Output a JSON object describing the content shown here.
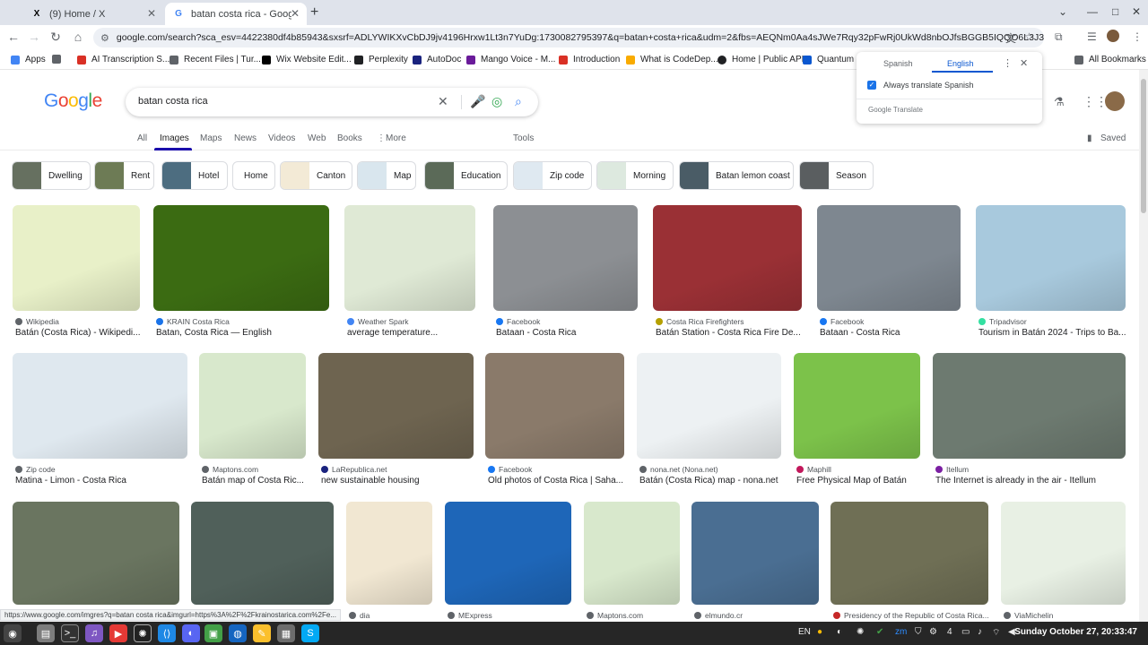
{
  "browser": {
    "tabs": [
      {
        "title": "(9) Home / X",
        "fav": "X"
      },
      {
        "title": "batan costa rica - Google Search",
        "fav": "G"
      }
    ],
    "url": "google.com/search?sca_esv=4422380df4b85943&sxsrf=ADLYWIKXvCbDJ9jv4196Hrxw1Lt3n7YuDg:1730082795397&q=batan+costa+rica&udm=2&fbs=AEQNm0Aa4sJWe7Rqy32pFwRj0UkWd8nbOJfsBGGB5IQQO6L3J3ppPdoHI1O-X...",
    "bookmarks": [
      {
        "label": "Apps",
        "color": "#4285f4"
      },
      {
        "label": "",
        "color": "#5f6368"
      },
      {
        "label": "AI Transcription S...",
        "color": "#d93025"
      },
      {
        "label": "Recent Files | Tur...",
        "color": "#5f6368"
      },
      {
        "label": "Wix Website Edit...",
        "color": "#000000"
      },
      {
        "label": "Perplexity",
        "color": "#202124"
      },
      {
        "label": "AutoDoc",
        "color": "#1a237e"
      },
      {
        "label": "Mango Voice - M...",
        "color": "#6a1b9a"
      },
      {
        "label": "Introduction",
        "color": "#d93025"
      },
      {
        "label": "What is CodeDep...",
        "color": "#f9ab00"
      },
      {
        "label": "Home | Public API",
        "color": "#202124"
      },
      {
        "label": "Quantum",
        "color": "#0b57d0"
      },
      {
        "label": "All Bookmarks",
        "color": "#5f6368"
      }
    ]
  },
  "translate": {
    "from": "Spanish",
    "to": "English",
    "checkbox": "Always translate Spanish",
    "footer": "Google Translate"
  },
  "search": {
    "query": "batan costa rica",
    "nav": [
      "All",
      "Images",
      "Maps",
      "News",
      "Videos",
      "Web",
      "Books",
      "More",
      "Tools"
    ],
    "saved": "Saved",
    "chips": [
      "Dwelling",
      "Rent",
      "Hotel",
      "Home",
      "Canton",
      "Map",
      "Education",
      "Zip code",
      "Morning",
      "Batan lemon coast",
      "Season"
    ]
  },
  "results": [
    {
      "source": "Wikipedia",
      "title": "Batán (Costa Rica) - Wikipedi...",
      "color": "#e8f0c8",
      "sc": "#5f6368"
    },
    {
      "source": "KRAIN Costa Rica",
      "title": "Batan, Costa Rica — English",
      "color": "#3b6b12",
      "sc": "#1a73e8"
    },
    {
      "source": "Weather Spark",
      "title": "average temperature...",
      "color": "#dfe9d5",
      "sc": "#4285f4"
    },
    {
      "source": "Facebook",
      "title": "Bataan - Costa Rica",
      "color": "#8c8f93",
      "sc": "#1877f2"
    },
    {
      "source": "Costa Rica Firefighters",
      "title": "Batán Station - Costa Rica Fire De...",
      "color": "#9a3035",
      "sc": "#b5a000"
    },
    {
      "source": "Facebook",
      "title": "Bataan - Costa Rica",
      "color": "#7e8790",
      "sc": "#1877f2"
    },
    {
      "source": "Tripadvisor",
      "title": "Tourism in Batán 2024 - Trips to Ba...",
      "color": "#a8c9dd",
      "sc": "#34e0a1"
    },
    {
      "source": "Zip code",
      "title": "Matina - Limon - Costa Rica",
      "color": "#dfe8ef",
      "sc": "#5f6368"
    },
    {
      "source": "Maptons.com",
      "title": "Batán map of Costa Ric...",
      "color": "#d8e8cc",
      "sc": "#5f6368"
    },
    {
      "source": "LaRepublica.net",
      "title": "new sustainable housing",
      "color": "#6e6450",
      "sc": "#1a237e"
    },
    {
      "source": "Facebook",
      "title": "Old photos of Costa Rica | Saha...",
      "color": "#8a7a6a",
      "sc": "#1877f2"
    },
    {
      "source": "nona.net (Nona.net)",
      "title": "Batán (Costa Rica) map - nona.net",
      "color": "#edf1f3",
      "sc": "#5f6368"
    },
    {
      "source": "Maphill",
      "title": "Free Physical Map of Batán",
      "color": "#7cc24a",
      "sc": "#c2185b"
    },
    {
      "source": "Itellum",
      "title": "The Internet is already in the air - Itellum",
      "color": "#6d7a70",
      "sc": "#7b1fa2"
    },
    {
      "source": "",
      "title": "",
      "color": "#6a7560",
      "sc": "#5f6368"
    },
    {
      "source": "",
      "title": "",
      "color": "#50605a",
      "sc": "#5f6368"
    },
    {
      "source": "dia",
      "title": "",
      "color": "#f1e7d2",
      "sc": "#5f6368"
    },
    {
      "source": "MExpress",
      "title": "",
      "color": "#1e66b8",
      "sc": "#5f6368"
    },
    {
      "source": "Maptons.com",
      "title": "",
      "color": "#d8e8cc",
      "sc": "#5f6368"
    },
    {
      "source": "elmundo.cr",
      "title": "",
      "color": "#4a6e92",
      "sc": "#5f6368"
    },
    {
      "source": "Presidency of the Republic of Costa Rica...",
      "title": "",
      "color": "#6f6f55",
      "sc": "#c62828"
    },
    {
      "source": "ViaMichelin",
      "title": "",
      "color": "#e8f0e4",
      "sc": "#5f6368"
    }
  ],
  "status_url": "https://www.google.com/imgres?q=batan costa rica&imgurl=https%3A%2F%2Fkrainostarica.com%2Fe...",
  "taskbar": {
    "lang": "EN",
    "clock": "Sunday October 27, 20:33:47"
  }
}
